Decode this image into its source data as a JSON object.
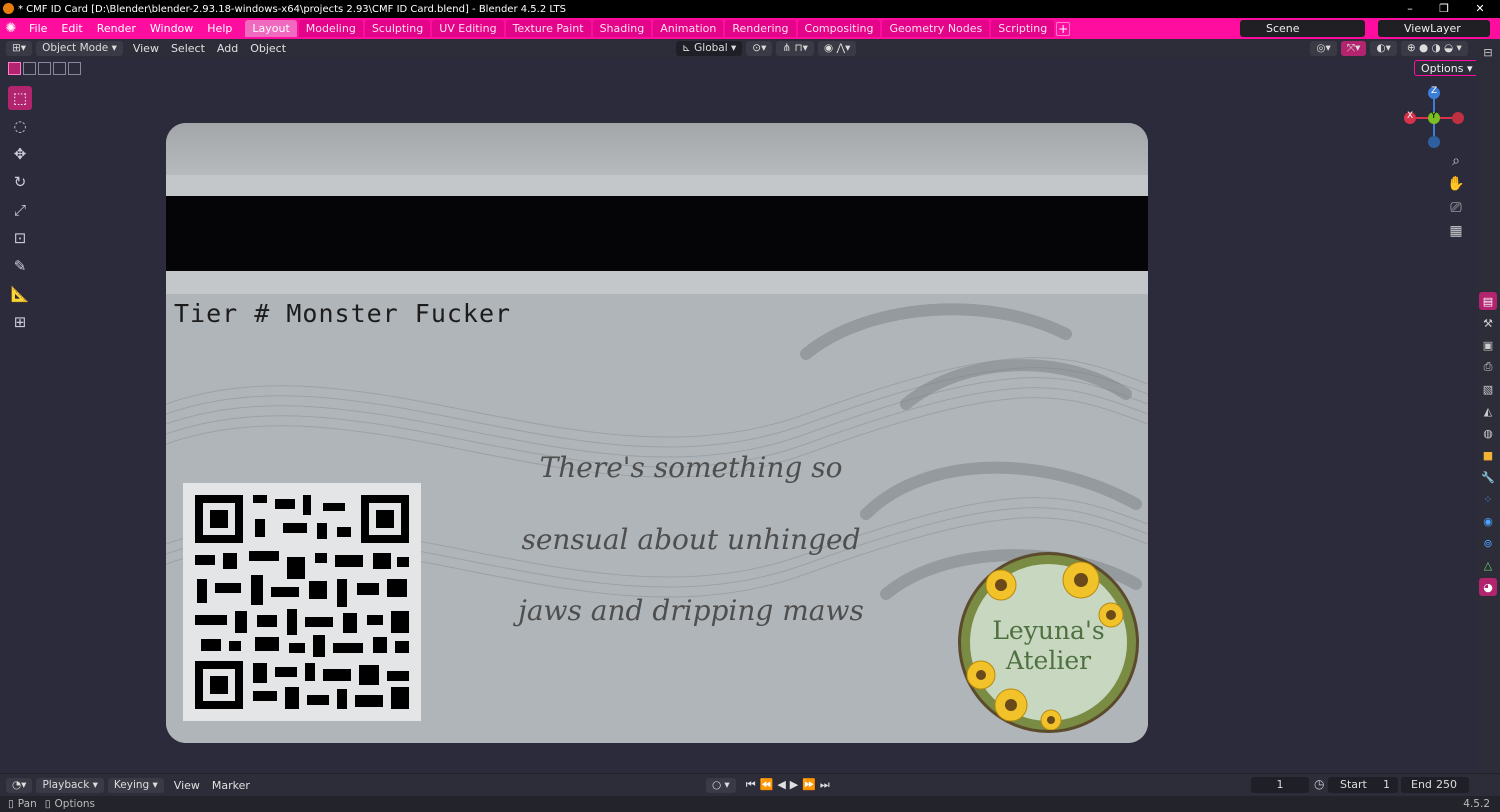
{
  "titlebar": {
    "title": "* CMF ID Card [D:\\Blender\\blender-2.93.18-windows-x64\\projects 2.93\\CMF ID Card.blend] - Blender 4.5.2 LTS",
    "minimize": "–",
    "restore": "❐",
    "close": "✕"
  },
  "menu": {
    "file": "File",
    "edit": "Edit",
    "render": "Render",
    "window": "Window",
    "help": "Help"
  },
  "workspaces": [
    {
      "label": "Layout",
      "active": true
    },
    {
      "label": "Modeling"
    },
    {
      "label": "Sculpting"
    },
    {
      "label": "UV Editing"
    },
    {
      "label": "Texture Paint"
    },
    {
      "label": "Shading"
    },
    {
      "label": "Animation"
    },
    {
      "label": "Rendering"
    },
    {
      "label": "Compositing"
    },
    {
      "label": "Geometry Nodes"
    },
    {
      "label": "Scripting"
    }
  ],
  "scene": {
    "name": "Scene",
    "view_layer": "ViewLayer"
  },
  "header3d": {
    "mode": "Object Mode",
    "view": "View",
    "select": "Select",
    "add": "Add",
    "object": "Object",
    "orientation": "Global",
    "options": "Options"
  },
  "card": {
    "tier_text": "Tier # Monster Fucker",
    "quote_line1": "There's something so",
    "quote_line2": "sensual about unhinged",
    "quote_line3": "jaws and dripping maws",
    "logo_line1": "Leyuna's",
    "logo_line2": "Atelier"
  },
  "gizmo": {
    "x": "X",
    "y": "Y",
    "z": "Z"
  },
  "timeline": {
    "playback": "Playback",
    "keying": "Keying",
    "view": "View",
    "marker": "Marker",
    "current_frame": "1",
    "start_label": "Start",
    "start": "1",
    "end_label": "End",
    "end": "250"
  },
  "status": {
    "pan": "Pan",
    "options": "Options",
    "version": "4.5.2"
  },
  "colors": {
    "accent": "#ff0d9e",
    "active_tool": "#b3246f",
    "viewport_bg": "#2c2b3b"
  }
}
